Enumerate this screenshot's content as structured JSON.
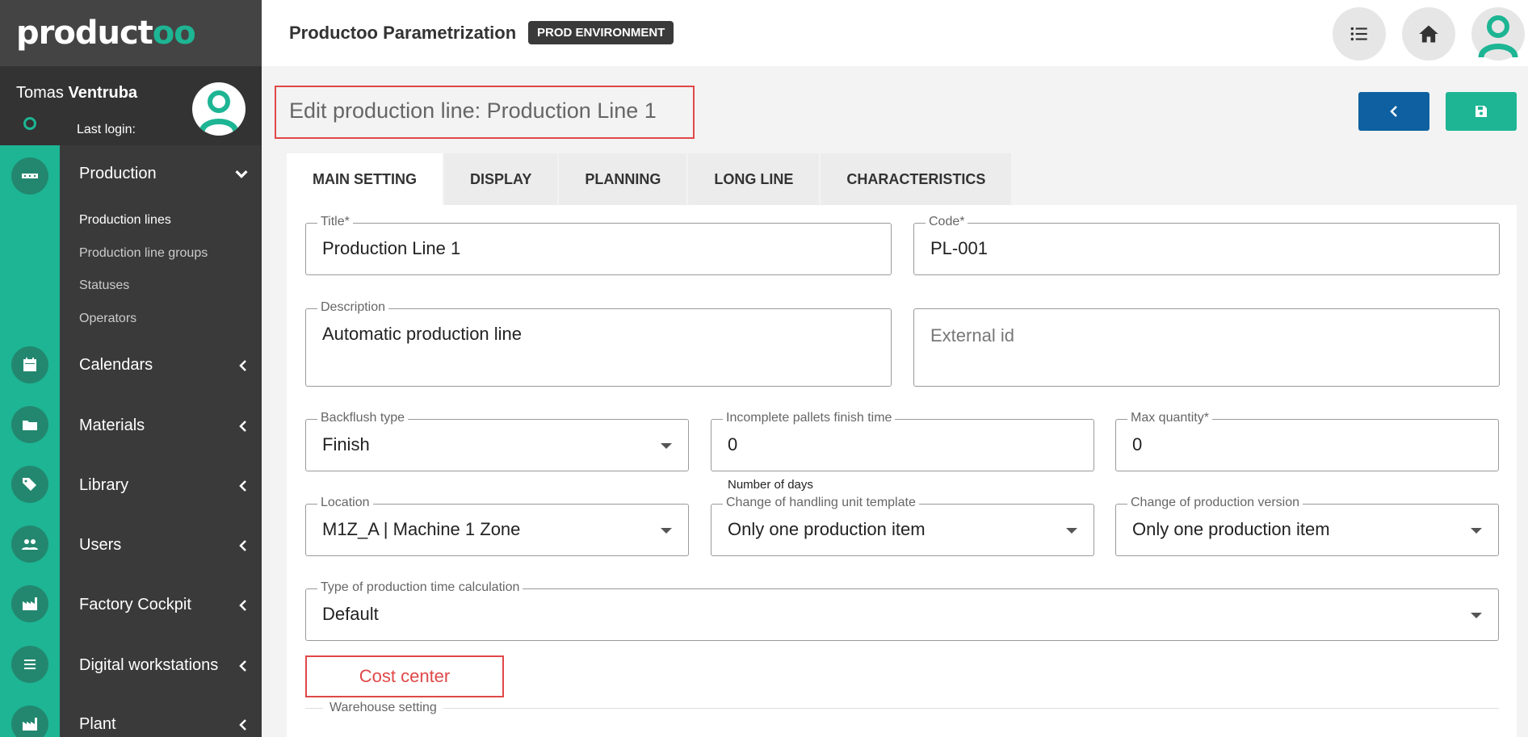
{
  "brand": {
    "logo_main": "product",
    "logo_accent": "oo"
  },
  "user": {
    "first_name": "Tomas",
    "last_name": "Ventruba",
    "last_login_label": "Last login:"
  },
  "topbar": {
    "title": "Productoo Parametrization",
    "env_badge": "PROD ENVIRONMENT"
  },
  "sidebar": {
    "production": {
      "label": "Production",
      "sub_items": [
        "Production lines",
        "Production line groups",
        "Statuses",
        "Operators"
      ]
    },
    "items": [
      "Calendars",
      "Materials",
      "Library",
      "Users",
      "Factory Cockpit",
      "Digital workstations",
      "Plant"
    ]
  },
  "page": {
    "title": "Edit production line: Production Line 1"
  },
  "tabs": [
    "MAIN SETTING",
    "DISPLAY",
    "PLANNING",
    "LONG LINE",
    "CHARACTERISTICS"
  ],
  "form": {
    "title": {
      "label": "Title*",
      "value": "Production Line 1"
    },
    "code": {
      "label": "Code*",
      "value": "PL-001"
    },
    "description": {
      "label": "Description",
      "value": "Automatic production line"
    },
    "external_id": {
      "placeholder": "External id"
    },
    "backflush": {
      "label": "Backflush type",
      "value": "Finish"
    },
    "incomplete": {
      "label": "Incomplete pallets finish time",
      "value": "0",
      "hint": "Number of days"
    },
    "max_quantity": {
      "label": "Max quantity*",
      "value": "0"
    },
    "location": {
      "label": "Location",
      "value": "M1Z_A | Machine 1 Zone"
    },
    "handling_unit": {
      "label": "Change of handling unit template",
      "value": "Only one production item"
    },
    "production_version": {
      "label": "Change of production version",
      "value": "Only one production item"
    },
    "time_calc": {
      "label": "Type of production time calculation",
      "value": "Default"
    },
    "cost_center": "Cost center",
    "warehouse_setting": "Warehouse setting"
  },
  "colors": {
    "accent": "#1db594",
    "sidebar": "#3a3a3a",
    "back_button": "#0e60a0",
    "highlight": "#e04848"
  }
}
